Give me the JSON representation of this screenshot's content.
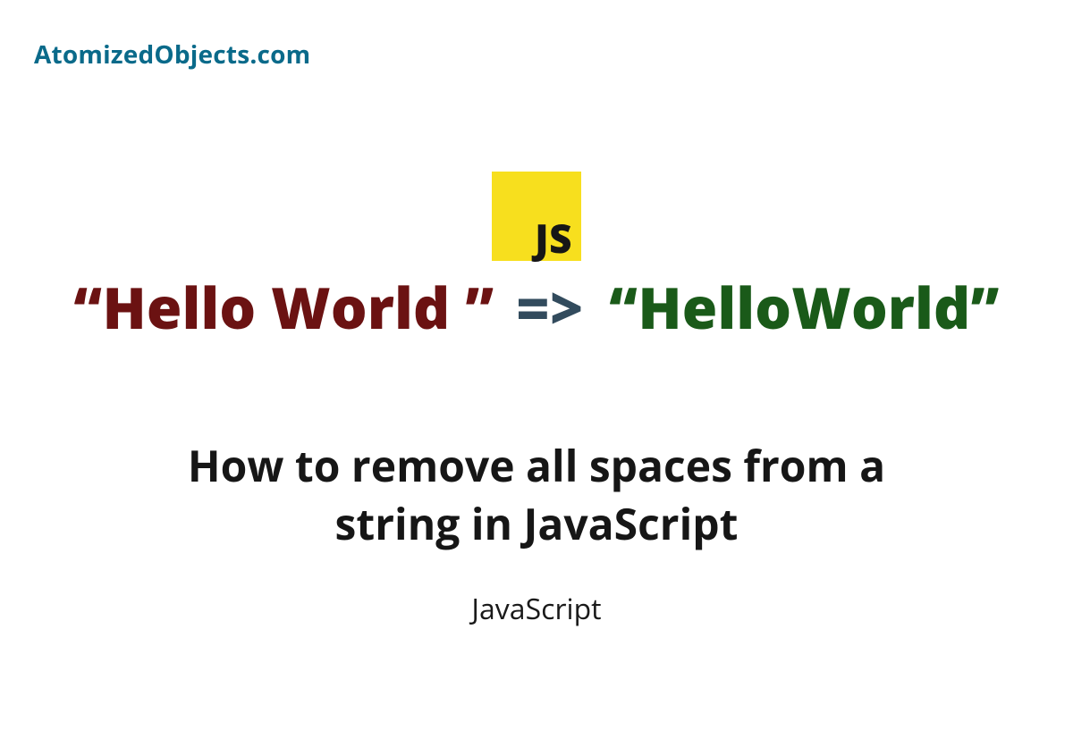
{
  "site": {
    "name": "AtomizedObjects.com"
  },
  "logo": {
    "text": "JS"
  },
  "code": {
    "before": "“Hello World ”",
    "arrow": "=>",
    "after": "“HelloWorld”"
  },
  "article": {
    "title": "How to remove all spaces from a string in JavaScript",
    "category": "JavaScript"
  }
}
